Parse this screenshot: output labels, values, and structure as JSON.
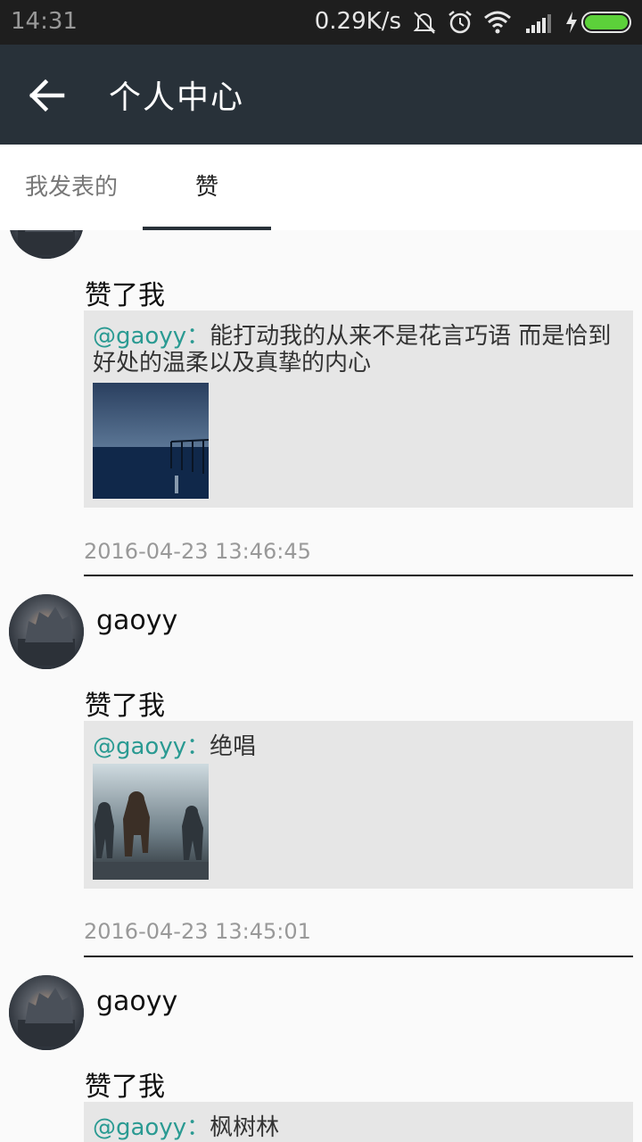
{
  "status_bar": {
    "time": "14:31",
    "net_speed": "0.29K/s",
    "icons": [
      "mute-icon",
      "alarm-icon",
      "wifi-icon",
      "signal-icon",
      "charging-icon",
      "battery-icon"
    ]
  },
  "header": {
    "title": "个人中心",
    "back_icon": "arrow-left-icon"
  },
  "tabs": [
    {
      "label": "我发表的",
      "selected": false
    },
    {
      "label": "赞",
      "selected": true
    }
  ],
  "feed": [
    {
      "username": "",
      "action": "赞了我",
      "mention": "@gaoyy",
      "sep": "：",
      "content": "能打动我的从来不是花言巧语 而是恰到好处的温柔以及真挚的内心",
      "image": "sea-pier-photo",
      "time": "2016-04-23 13:46:45"
    },
    {
      "username": "gaoyy",
      "action": "赞了我",
      "mention": "@gaoyy",
      "sep": "：",
      "content": "绝唱",
      "image": "soldiers-game-art",
      "time": "2016-04-23 13:45:01"
    },
    {
      "username": "gaoyy",
      "action": "赞了我",
      "mention": "@gaoyy",
      "sep": "：",
      "content": "枫树林",
      "image": "",
      "time": ""
    }
  ],
  "colors": {
    "status_bar": "#1e1e1e",
    "app_bar": "#283139",
    "mention": "#2a9a92",
    "quote_bg": "#e6e6e6",
    "battery": "#5cd13a"
  }
}
